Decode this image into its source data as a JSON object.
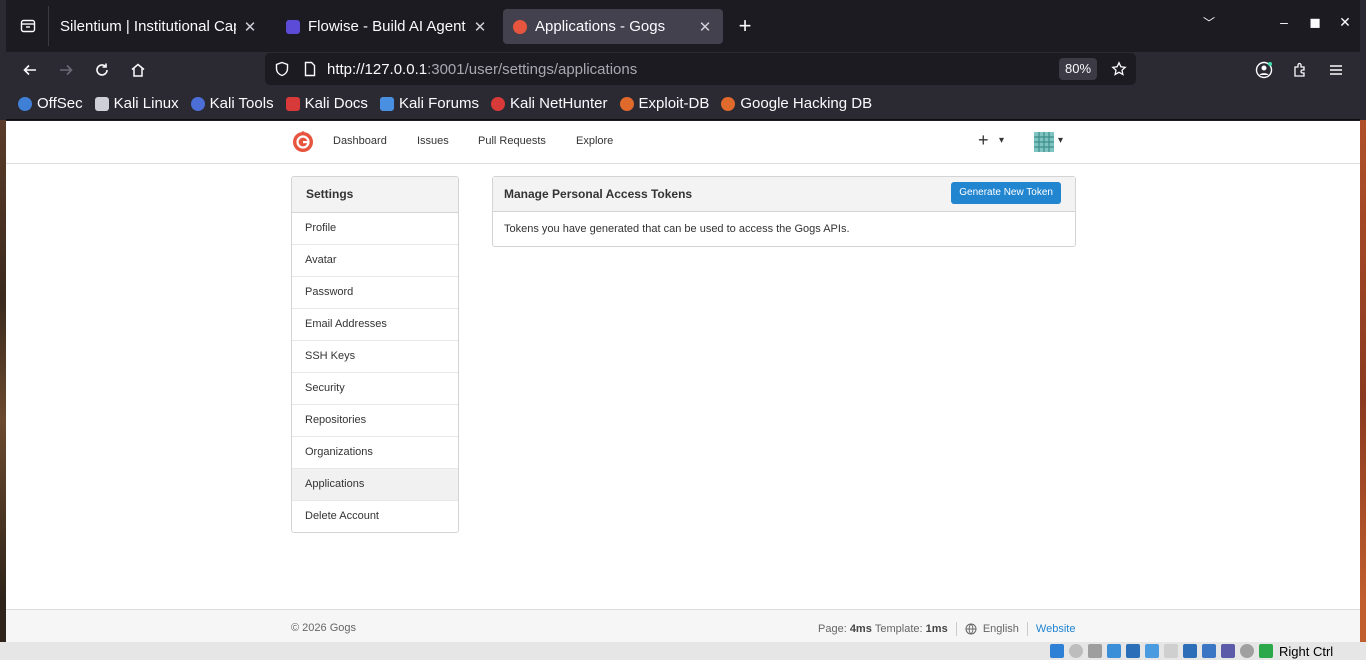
{
  "browser": {
    "tabs": [
      {
        "title": "Silentium | Institutional Capit",
        "favicon_color": "#2b2a33",
        "active": false
      },
      {
        "title": "Flowise - Build AI Agents,",
        "favicon_color": "#5b4bd6",
        "active": false
      },
      {
        "title": "Applications - Gogs",
        "favicon_color": "#e8553e",
        "active": true
      }
    ],
    "new_tab_label": "+",
    "url_host": "http://127.0.0.1",
    "url_path": ":3001/user/settings/applications",
    "zoom": "80%",
    "bookmarks": [
      {
        "label": "OffSec",
        "color": "#3f7fd6"
      },
      {
        "label": "Kali Linux",
        "color": "#cfcfd8"
      },
      {
        "label": "Kali Tools",
        "color": "#4b6fd6"
      },
      {
        "label": "Kali Docs",
        "color": "#d83a3a"
      },
      {
        "label": "Kali Forums",
        "color": "#4a90e2"
      },
      {
        "label": "Kali NetHunter",
        "color": "#d83a3a"
      },
      {
        "label": "Exploit-DB",
        "color": "#e06a2c"
      },
      {
        "label": "Google Hacking DB",
        "color": "#e06a2c"
      }
    ]
  },
  "page": {
    "nav": {
      "items": [
        "Dashboard",
        "Issues",
        "Pull Requests",
        "Explore"
      ],
      "plus": "+",
      "caret": "▾"
    },
    "sidebar": {
      "title": "Settings",
      "items": [
        "Profile",
        "Avatar",
        "Password",
        "Email Addresses",
        "SSH Keys",
        "Security",
        "Repositories",
        "Organizations",
        "Applications",
        "Delete Account"
      ],
      "active": "Applications"
    },
    "panel": {
      "title": "Manage Personal Access Tokens",
      "button": "Generate New Token",
      "body": "Tokens you have generated that can be used to access the Gogs APIs."
    },
    "footer": {
      "copyright": "© 2026 Gogs",
      "page_label": "Page:",
      "page_time": "4ms",
      "template_label": "Template:",
      "template_time": "1ms",
      "language": "English",
      "website": "Website"
    },
    "colors": {
      "primary": "#2185d0",
      "logo": "#e8553e"
    }
  },
  "host": {
    "label": "Right Ctrl"
  }
}
